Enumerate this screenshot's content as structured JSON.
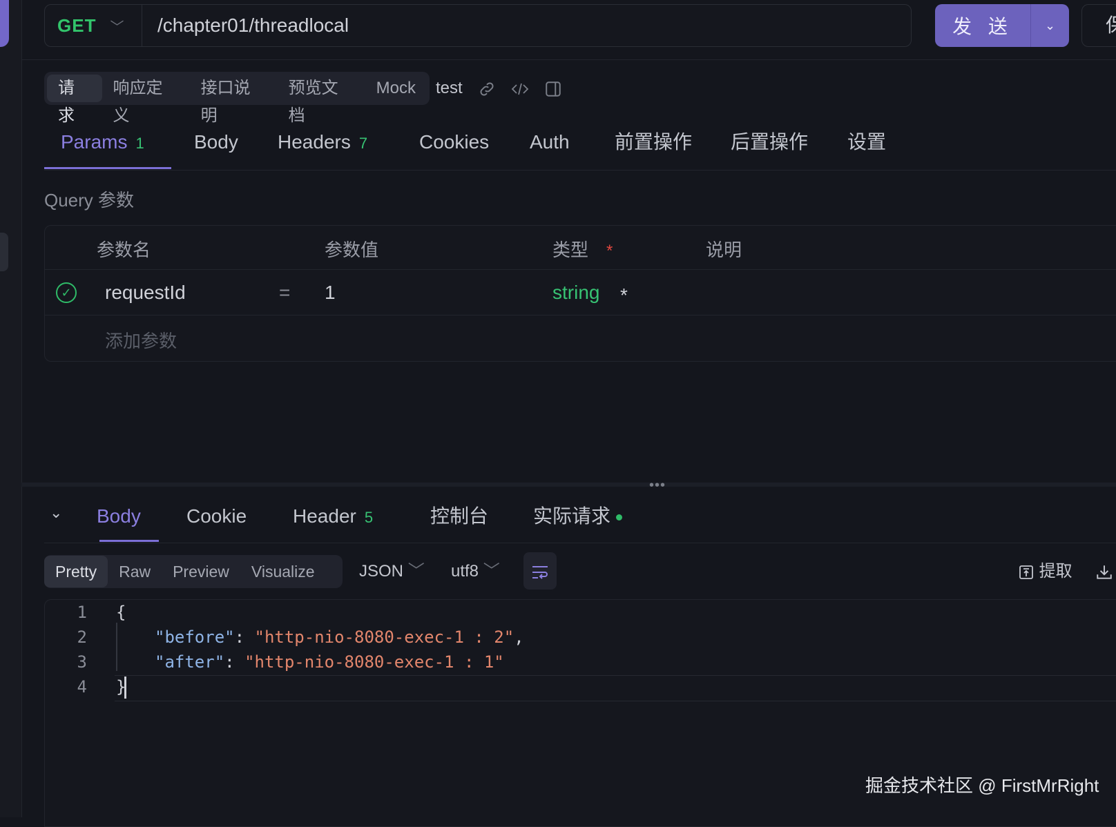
{
  "url_bar": {
    "method": "GET",
    "url": "/chapter01/threadlocal",
    "send_label": "发 送",
    "save_label": "保"
  },
  "request_tabs": [
    "请求",
    "响应定义",
    "接口说明",
    "预览文档",
    "Mock"
  ],
  "environment": "test",
  "params_tabs": [
    {
      "label": "Params",
      "count": "1"
    },
    {
      "label": "Body"
    },
    {
      "label": "Headers",
      "count": "7"
    },
    {
      "label": "Cookies"
    },
    {
      "label": "Auth"
    },
    {
      "label": "前置操作"
    },
    {
      "label": "后置操作"
    },
    {
      "label": "设置"
    }
  ],
  "query_section_label": "Query 参数",
  "params_table": {
    "headers": [
      "参数名",
      "参数值",
      "类型",
      "说明"
    ],
    "required_mark": "*",
    "rows": [
      {
        "enabled": true,
        "name": "requestId",
        "eq": "=",
        "value": "1",
        "type": "string",
        "required": "*"
      }
    ],
    "add_placeholder": "添加参数"
  },
  "response_tabs": [
    {
      "label": "Body"
    },
    {
      "label": "Cookie"
    },
    {
      "label": "Header",
      "count": "5"
    },
    {
      "label": "控制台"
    },
    {
      "label": "实际请求"
    }
  ],
  "view_modes": [
    "Pretty",
    "Raw",
    "Preview",
    "Visualize"
  ],
  "format": "JSON",
  "encoding": "utf8",
  "extract_label": "提取",
  "code": {
    "line_numbers": [
      "1",
      "2",
      "3",
      "4"
    ],
    "open_brace": "{",
    "close_brace": "}",
    "lines": [
      {
        "key": "\"before\"",
        "value": "\"http-nio-8080-exec-1 : 2\"",
        "trail": ","
      },
      {
        "key": "\"after\"",
        "value": "\"http-nio-8080-exec-1 : 1\"",
        "trail": ""
      }
    ]
  },
  "watermark": "掘金技术社区 @ FirstMrRight",
  "colors": {
    "accent": "#7b6fd6",
    "method_get": "#32c46b",
    "badge_green": "#37c273",
    "required_red": "#e0473f",
    "json_key": "#8fb4e6",
    "json_string": "#e3866c"
  },
  "icons": [
    "link-icon",
    "code-icon",
    "panel-icon",
    "chevron-down-icon",
    "check-circle-icon",
    "wrap-lines-icon",
    "extract-icon",
    "download-icon"
  ]
}
